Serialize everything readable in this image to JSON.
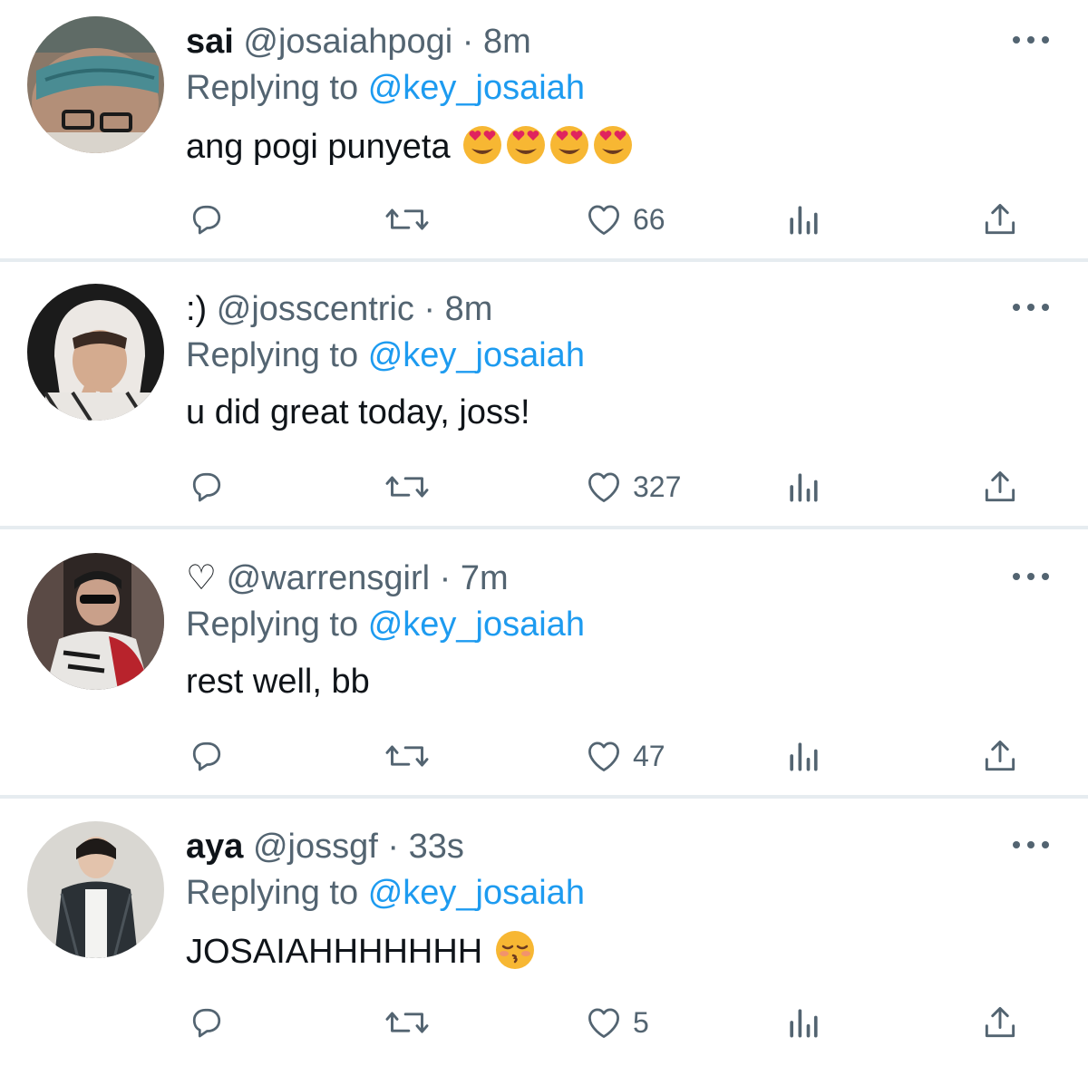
{
  "tweets": [
    {
      "display_name": "sai",
      "handle": "@josaiahpogi",
      "separator": "·",
      "time": "8m",
      "replying_prefix": "Replying to",
      "replying_to": "@key_josaiah",
      "text": "ang pogi punyeta",
      "emoji": [
        "heart-eyes-emoji",
        "heart-eyes-emoji",
        "heart-eyes-emoji",
        "heart-eyes-emoji"
      ],
      "likes": "66",
      "avatar": "avatar-sai"
    },
    {
      "display_name": ":)",
      "handle": "@josscentric",
      "separator": "·",
      "time": "8m",
      "replying_prefix": "Replying to",
      "replying_to": "@key_josaiah",
      "text": "u did great today, joss!",
      "emoji": [],
      "likes": "327",
      "avatar": "avatar-josscentric"
    },
    {
      "display_name": "♡",
      "handle": "@warrensgirl",
      "separator": "·",
      "time": "7m",
      "replying_prefix": "Replying to",
      "replying_to": "@key_josaiah",
      "text": "rest well, bb",
      "emoji": [],
      "likes": "47",
      "avatar": "avatar-warrensgirl"
    },
    {
      "display_name": "aya",
      "handle": "@jossgf",
      "separator": "·",
      "time": "33s",
      "replying_prefix": "Replying to",
      "replying_to": "@key_josaiah",
      "text": "JOSAIAHHHHHHH",
      "emoji": [
        "kissing-closed-eyes-emoji"
      ],
      "likes": "5",
      "avatar": "avatar-jossgf"
    }
  ],
  "icons": {
    "reply": "reply-icon",
    "retweet": "retweet-icon",
    "like": "heart-icon",
    "views": "views-icon",
    "share": "share-icon",
    "more": "more-icon"
  },
  "colors": {
    "text": "#0f1419",
    "secondary": "#536471",
    "link": "#1d9bf0",
    "divider": "#e6ecf0"
  }
}
